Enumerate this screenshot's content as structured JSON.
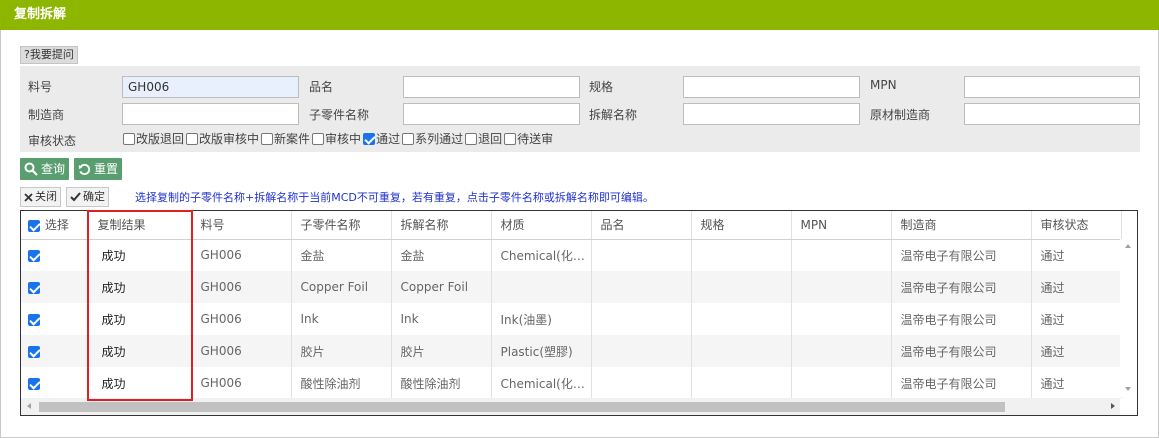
{
  "window": {
    "title": "复制拆解"
  },
  "ask_button": "?我要提问",
  "filters": {
    "part_no": {
      "label": "料号",
      "value": "GH006"
    },
    "product_name": {
      "label": "品名",
      "value": ""
    },
    "spec": {
      "label": "规格",
      "value": ""
    },
    "mpn": {
      "label": "MPN",
      "value": ""
    },
    "manufacturer": {
      "label": "制造商",
      "value": ""
    },
    "sub_part_name": {
      "label": "子零件名称",
      "value": ""
    },
    "disassembly_name": {
      "label": "拆解名称",
      "value": ""
    },
    "raw_manufacturer": {
      "label": "原材制造商",
      "value": ""
    },
    "review_status": {
      "label": "审核状态",
      "options": [
        {
          "label": "改版退回",
          "checked": false
        },
        {
          "label": "改版审核中",
          "checked": false
        },
        {
          "label": "新案件",
          "checked": false
        },
        {
          "label": "审核中",
          "checked": false
        },
        {
          "label": "通过",
          "checked": true
        },
        {
          "label": "系列通过",
          "checked": false
        },
        {
          "label": "退回",
          "checked": false
        },
        {
          "label": "待送审",
          "checked": false
        }
      ]
    }
  },
  "actions": {
    "search": "查询",
    "reset": "重置",
    "close": "关闭",
    "confirm": "确定"
  },
  "notice": "选择复制的子零件名称+拆解名称于当前MCD不可重复，若有重复，点击子零件名称或拆解名称即可编辑。",
  "table": {
    "select_header": "选择",
    "columns": [
      "复制结果",
      "料号",
      "子零件名称",
      "拆解名称",
      "材质",
      "品名",
      "规格",
      "MPN",
      "制造商",
      "审核状态"
    ],
    "rows": [
      {
        "checked": true,
        "cells": [
          "成功",
          "GH006",
          "金盐",
          "金盐",
          "Chemical(化…",
          "",
          "",
          "",
          "温帝电子有限公司",
          "通过"
        ]
      },
      {
        "checked": true,
        "cells": [
          "成功",
          "GH006",
          "Copper Foil",
          "Copper Foil",
          "",
          "",
          "",
          "",
          "温帝电子有限公司",
          "通过"
        ]
      },
      {
        "checked": true,
        "cells": [
          "成功",
          "GH006",
          "Ink",
          "Ink",
          "Ink(油墨)",
          "",
          "",
          "",
          "温帝电子有限公司",
          "通过"
        ]
      },
      {
        "checked": true,
        "cells": [
          "成功",
          "GH006",
          "胶片",
          "胶片",
          "Plastic(塑膠)",
          "",
          "",
          "",
          "温帝电子有限公司",
          "通过"
        ]
      },
      {
        "checked": true,
        "cells": [
          "成功",
          "GH006",
          "酸性除油剂",
          "酸性除油剂",
          "Chemical(化…",
          "",
          "",
          "",
          "温帝电子有限公司",
          "通过"
        ]
      }
    ]
  },
  "colors": {
    "title_bar": "#8db600",
    "action_button": "#5a9e6f",
    "highlight": "#e02020",
    "notice": "#2233cc",
    "checkbox": "#1a73e8"
  }
}
